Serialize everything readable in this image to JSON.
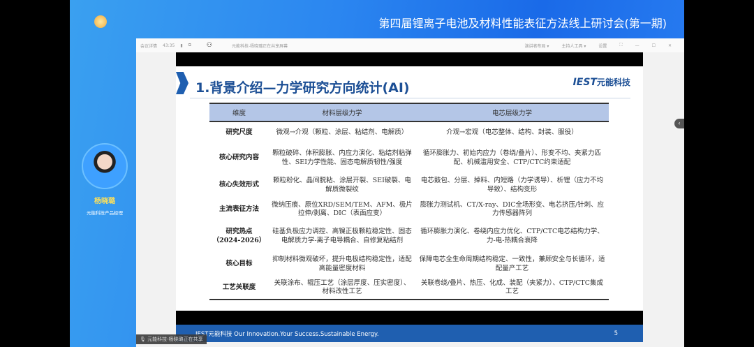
{
  "banner": {
    "title": "第四届锂离子电池及材料性能表征方法线上研讨会(第一期)"
  },
  "toolbar": {
    "meeting_info": "会议详情",
    "timer": "43:35",
    "sharing": "元能科技-杨晓璐正在共享屏幕",
    "layout": "演讲者布局 ▾",
    "host_tools": "主持人工具 ▾",
    "settings": "设置"
  },
  "speaker": {
    "name": "杨晓璐",
    "role": "元能科技产品经理"
  },
  "slide": {
    "title": "1.背景介绍—力学研究方向统计(AI)",
    "logo": "IEST",
    "logo_cn": "元能科技",
    "footer": "IEST元能科技 Our Innovation.Your Success.Sustainable Energy.",
    "page": "5",
    "table": {
      "headers": [
        "维度",
        "材料层级力学",
        "电芯层级力学"
      ],
      "rows": [
        [
          "研究尺度",
          "微观→介观（颗粒、涂层、粘结剂、电解质）",
          "介观→宏观（电芯整体、结构、封装、服役）"
        ],
        [
          "核心研究内容",
          "颗粒破碎、体积膨胀、内应力演化、粘结剂粘弹性、SEI力学性能、固态电解质韧性/强度",
          "循环膨胀力、初始内应力（卷绕/叠片）、形变不均、夹紧力匹配、机械滥用安全、CTP/CTC约束适配"
        ],
        [
          "核心失效形式",
          "颗粒粉化、晶间脱粘、涂层开裂、SEI破裂、电解质微裂纹",
          "电芯鼓包、分层、掉料、内短路（力学诱导）、析锂（应力不均导致）、结构变形"
        ],
        [
          "主流表征方法",
          "微纳压痕、原位XRD/SEM/TEM、AFM、极片拉伸/剥离、DIC（表面应变）",
          "膨胀力测试机、CT/X-ray、DIC全场形变、电芯挤压/针刺、应力传感器阵列"
        ],
        [
          "研究热点（2024-2026）",
          "硅基负极应力调控、高镍正极颗粒稳定性、固态电解质力学-离子电导耦合、自修复粘结剂",
          "循环膨胀力演化、卷绕内应力优化、CTP/CTC电芯结构力学、力-电-热耦合衰降"
        ],
        [
          "核心目标",
          "抑制材料微观破坏，提升电极结构稳定性，适配高能量密度材料",
          "保障电芯全生命周期结构稳定、一致性，兼顾安全与长循环，适配量产工艺"
        ],
        [
          "工艺关联度",
          "关联涂布、辊压工艺（涂层厚度、压实密度）、材料改性工艺",
          "关联卷绕/叠片、热压、化成、装配（夹紧力）、CTP/CTC集成工艺"
        ]
      ]
    }
  },
  "share_tag": "元能科技-杨晓璐正在共享"
}
